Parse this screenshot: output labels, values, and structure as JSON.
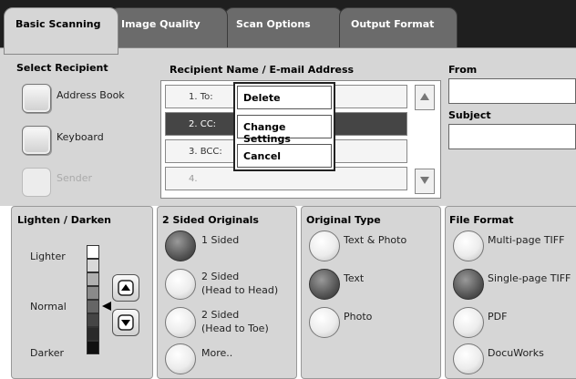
{
  "tabs": {
    "basic": "Basic Scanning",
    "quality": "Image Quality",
    "options": "Scan Options",
    "format": "Output Format"
  },
  "select_recipient": {
    "title": "Select Recipient",
    "address_book": "Address Book",
    "keyboard": "Keyboard",
    "sender": "Sender"
  },
  "recipients": {
    "title": "Recipient Name / E-mail Address",
    "rows": [
      {
        "label": "1.  To:"
      },
      {
        "label": "2.  CC:"
      },
      {
        "label": "3.  BCC:"
      },
      {
        "label": "4."
      }
    ]
  },
  "popup": {
    "delete": "Delete",
    "change": "Change Settings",
    "cancel": "Cancel"
  },
  "from": {
    "label": "From",
    "value": ""
  },
  "subject": {
    "label": "Subject",
    "value": ""
  },
  "lighten": {
    "title": "Lighten / Darken",
    "lighter": "Lighter",
    "normal": "Normal",
    "darker": "Darker",
    "level": "Normal"
  },
  "sided": {
    "title": "2 Sided Originals",
    "opt1": "1 Sided",
    "opt2a": "2 Sided",
    "opt2b": "(Head to Head)",
    "opt3a": "2 Sided",
    "opt3b": "(Head to Toe)",
    "opt4": "More..",
    "selected": "1 Sided"
  },
  "orig_type": {
    "title": "Original Type",
    "opt1": "Text & Photo",
    "opt2": "Text",
    "opt3": "Photo",
    "selected": "Text"
  },
  "file_format": {
    "title": "File Format",
    "opt1": "Multi-page TIFF",
    "opt2": "Single-page TIFF",
    "opt3": "PDF",
    "opt4": "DocuWorks",
    "selected": "Single-page TIFF"
  },
  "colors": {
    "tabstrip": "#1f1f1f",
    "panel": "#d6d6d6",
    "selected_row": "#454545"
  }
}
